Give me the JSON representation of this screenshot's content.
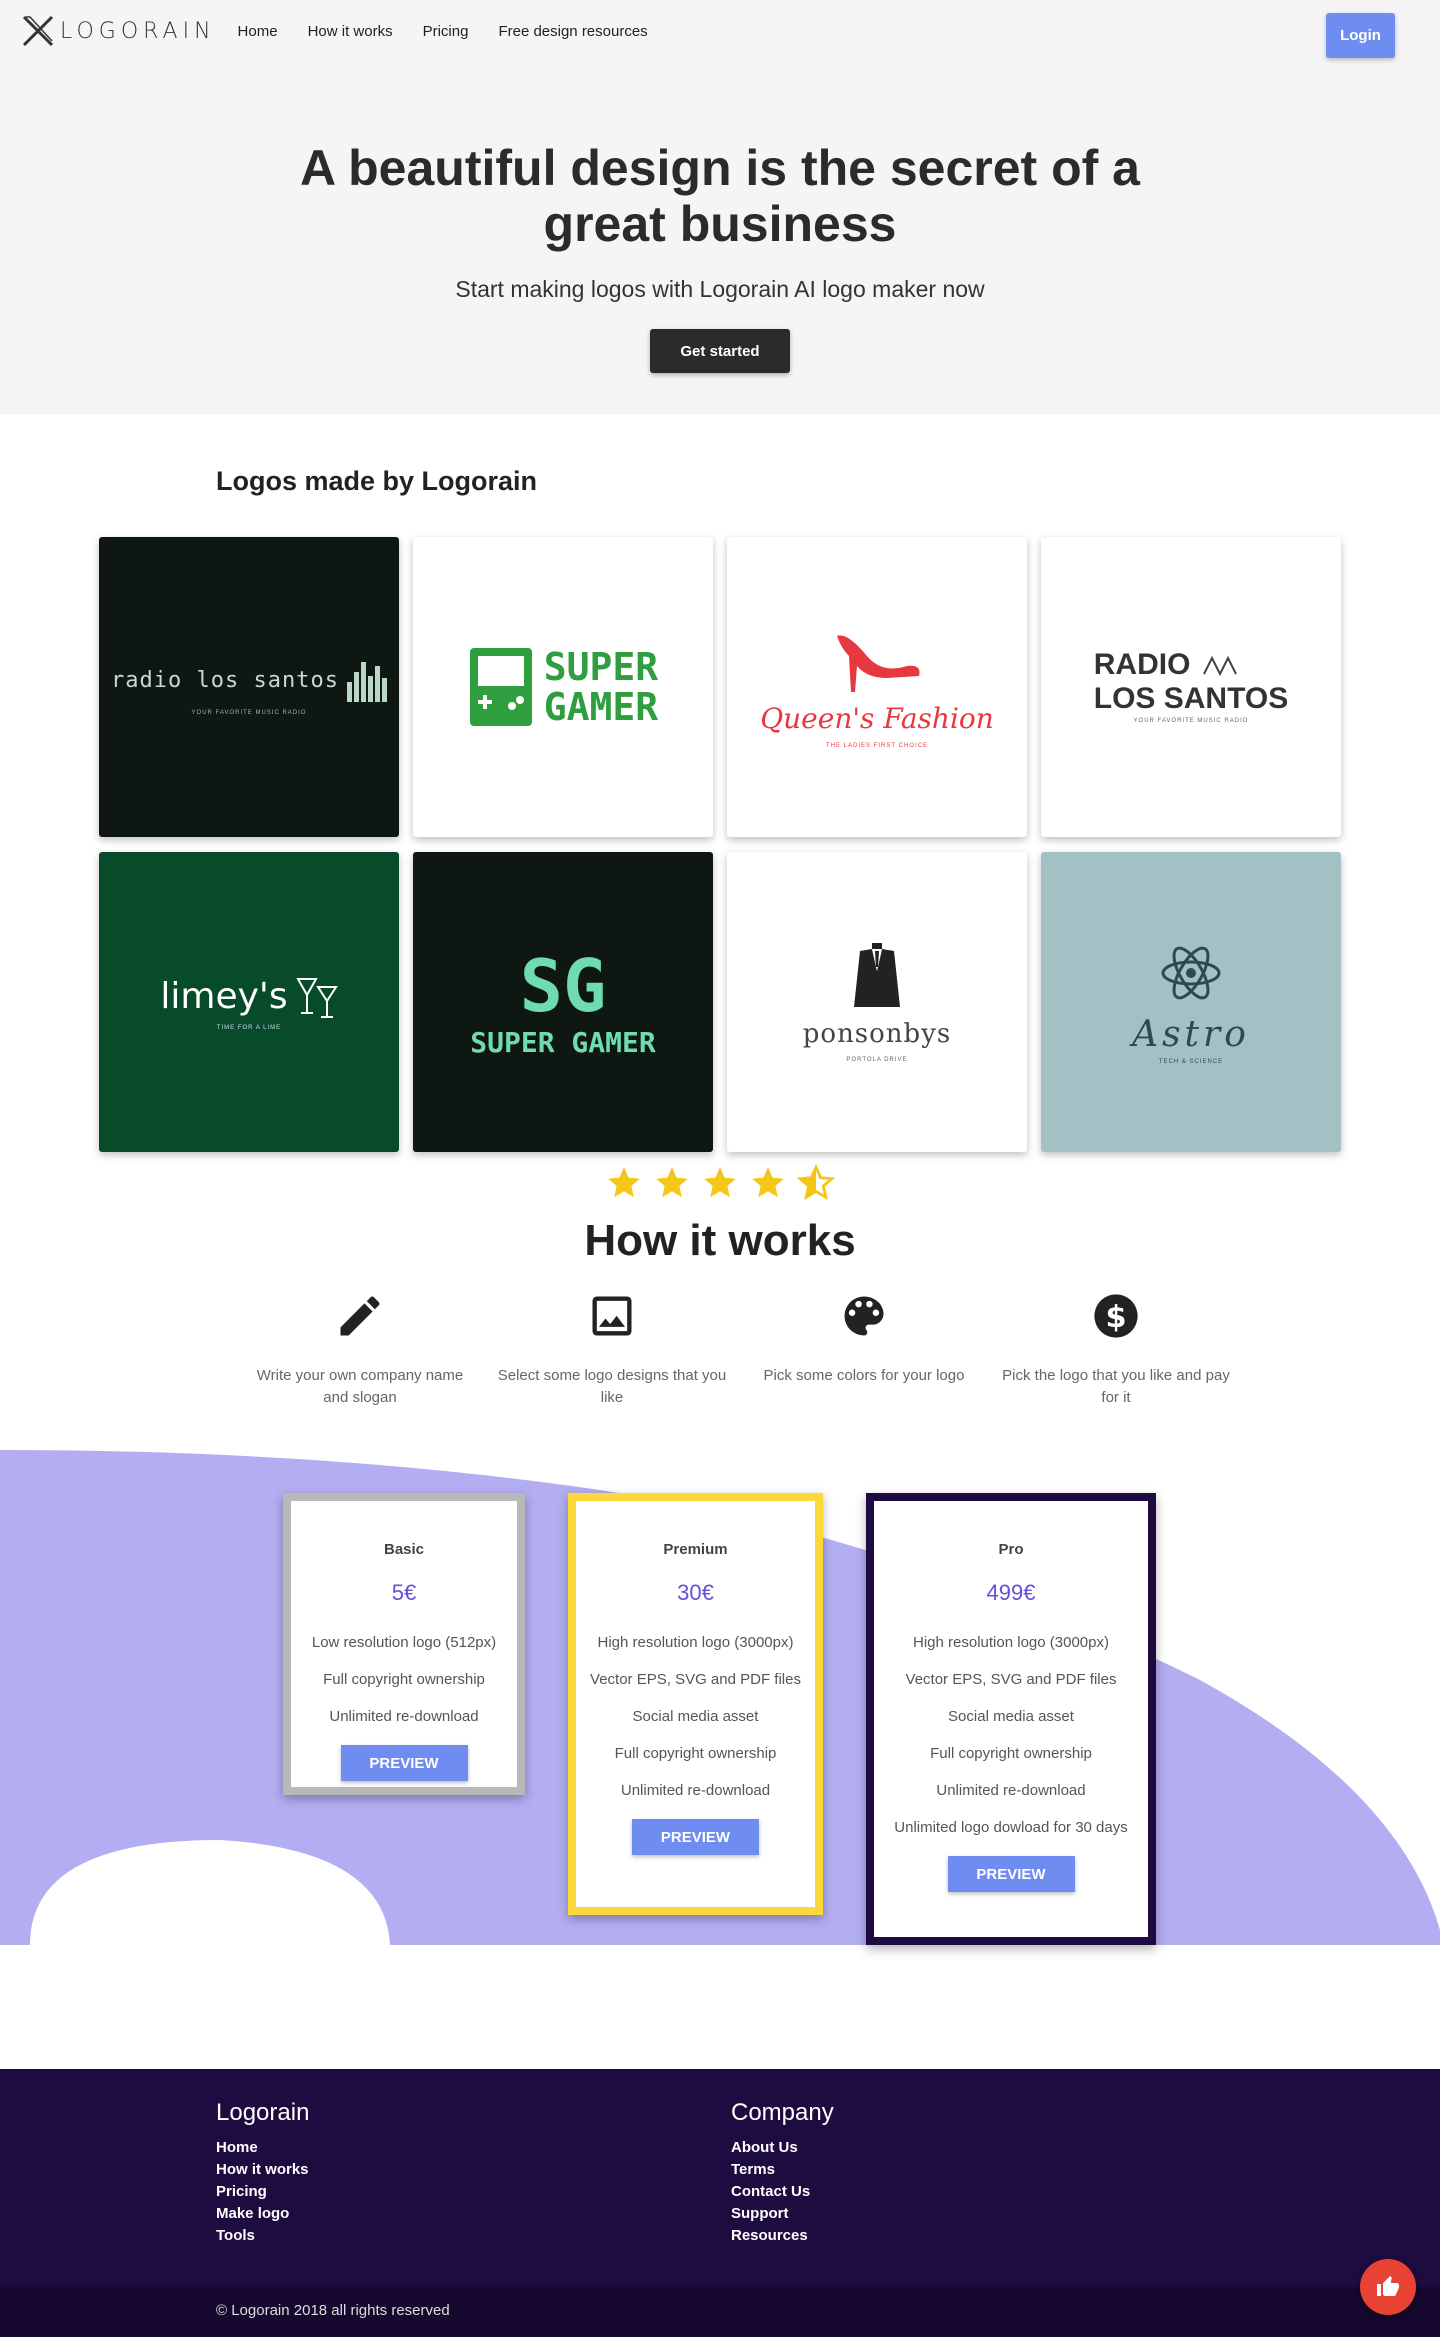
{
  "nav": {
    "brand": "LOGORAIN",
    "links": [
      "Home",
      "How it works",
      "Pricing",
      "Free design resources"
    ],
    "login": "Login"
  },
  "hero": {
    "title": "A beautiful design is the secret of a great business",
    "subtitle": "Start making logos with Logorain AI logo maker now",
    "cta": "Get started"
  },
  "logos": {
    "title": "Logos made by Logorain",
    "items": [
      {
        "name": "radio los santos",
        "tagline": "YOUR FAVORITE MUSIC RADIO"
      },
      {
        "name1": "SUPER",
        "name2": "GAMER"
      },
      {
        "name": "Queen's Fashion",
        "tagline": "THE LADIES FIRST CHOICE"
      },
      {
        "name1": "RADIO",
        "name2": "LOS SANTOS",
        "tagline": "YOUR FAVORITE MUSIC RADIO"
      },
      {
        "name": "limey's",
        "tagline": "TIME FOR A LIME"
      },
      {
        "mono": "SG",
        "name": "SUPER GAMER"
      },
      {
        "name": "ponsonbys",
        "tagline": "PORTOLA DRIVE"
      },
      {
        "name": "Astro",
        "tagline": "TECH & SCIENCE"
      }
    ]
  },
  "rating": {
    "stars": 4.5
  },
  "how": {
    "title": "How it works",
    "steps": [
      {
        "icon": "pencil-icon",
        "text": "Write your own company name and slogan"
      },
      {
        "icon": "image-icon",
        "text": "Select some logo designs that you like"
      },
      {
        "icon": "palette-icon",
        "text": "Pick some colors for your logo"
      },
      {
        "icon": "dollar-icon",
        "text": "Pick the logo that you like and pay for it"
      }
    ]
  },
  "pricing": {
    "plans": [
      {
        "name": "Basic",
        "price": "5€",
        "features": [
          "Low resolution logo (512px)",
          "Full copyright ownership",
          "Unlimited re-download"
        ],
        "button": "PREVIEW"
      },
      {
        "name": "Premium",
        "price": "30€",
        "features": [
          "High resolution logo (3000px)",
          "Vector EPS, SVG and PDF files",
          "Social media asset",
          "Full copyright ownership",
          "Unlimited re-download"
        ],
        "button": "PREVIEW"
      },
      {
        "name": "Pro",
        "price": "499€",
        "features": [
          "High resolution logo (3000px)",
          "Vector EPS, SVG and PDF files",
          "Social media asset",
          "Full copyright ownership",
          "Unlimited re-download",
          "Unlimited logo dowload for 30 days"
        ],
        "button": "PREVIEW"
      }
    ]
  },
  "footer": {
    "col1": {
      "title": "Logorain",
      "links": [
        "Home",
        "How it works",
        "Pricing",
        "Make logo",
        "Tools"
      ]
    },
    "col2": {
      "title": "Company",
      "links": [
        "About Us",
        "Terms",
        "Contact Us",
        "Support",
        "Resources"
      ]
    },
    "copyright": "© Logorain 2018 all rights reserved"
  },
  "colors": {
    "accent": "#6f8cf0",
    "purple": "#b3aef2",
    "footer": "#1e0b40",
    "star": "#f5c518"
  }
}
